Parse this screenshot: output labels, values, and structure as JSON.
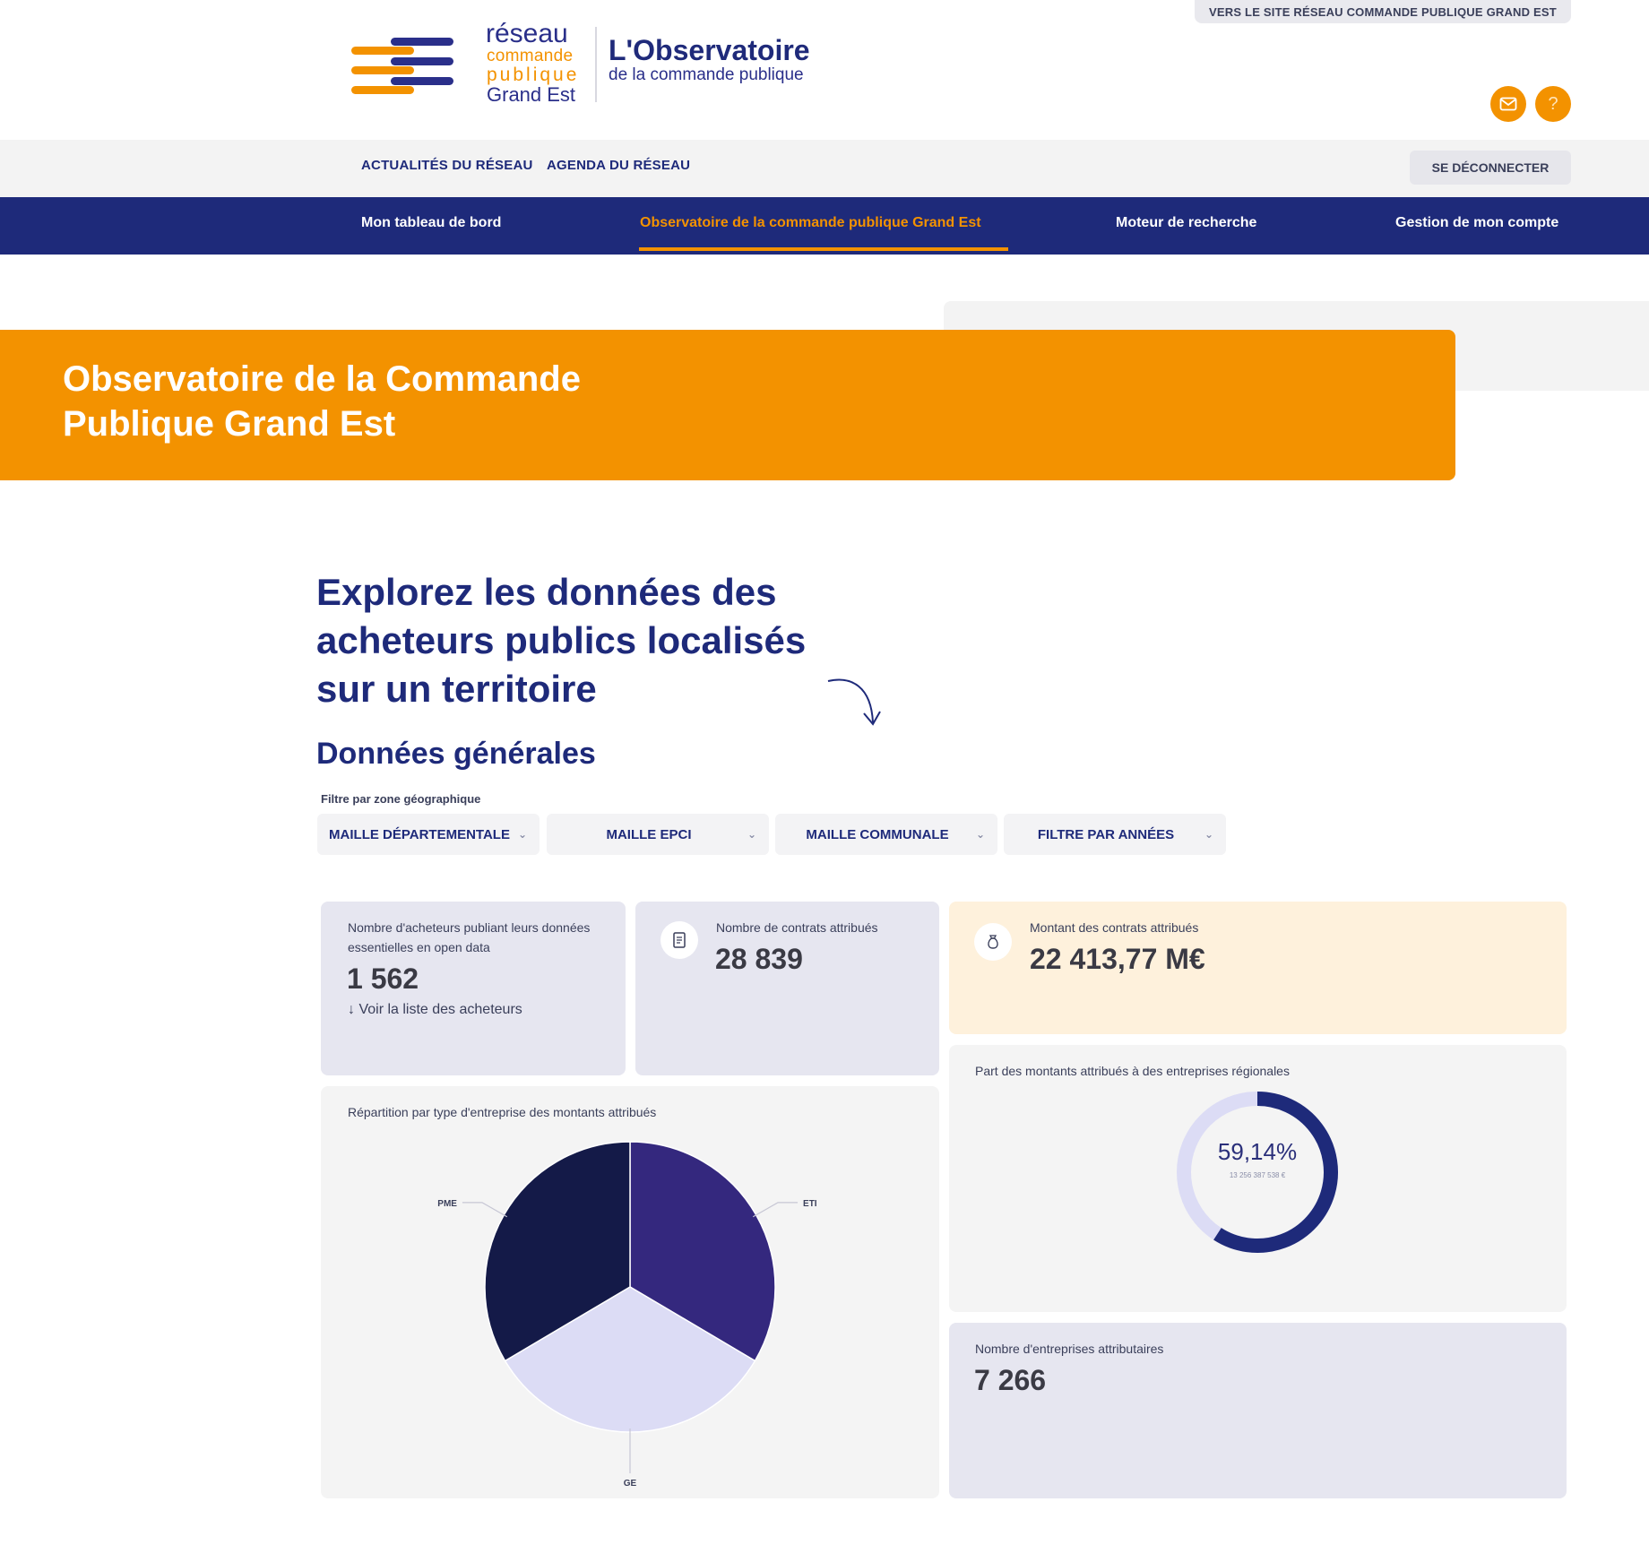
{
  "header": {
    "top_link": "VERS LE SITE RÉSEAU COMMANDE PUBLIQUE GRAND EST",
    "logo": {
      "line1": "réseau",
      "line2": "commande",
      "line3": "publique",
      "line4": "Grand Est"
    },
    "title": "L'Observatoire",
    "subtitle": "de la commande publique",
    "icons": [
      "mail-icon",
      "help-icon"
    ],
    "help_glyph": "?"
  },
  "subnav": {
    "links": [
      "ACTUALITÉS DU RÉSEAU",
      "AGENDA DU RÉSEAU"
    ],
    "logout": "SE DÉCONNECTER"
  },
  "mainnav": {
    "items": [
      {
        "label": "Mon tableau de bord",
        "active": false
      },
      {
        "label": "Observatoire de la commande publique Grand Est",
        "active": true
      },
      {
        "label": "Moteur de recherche",
        "active": false
      },
      {
        "label": "Gestion de mon compte",
        "active": false
      }
    ]
  },
  "banner": {
    "title": "Observatoire de la Commande Publique Grand Est"
  },
  "section": {
    "headline": "Explorez les données des acheteurs publics localisés sur un territoire",
    "subtitle": "Données générales",
    "filter_label": "Filtre par zone géographique",
    "filters": [
      "MAILLE DÉPARTEMENTALE",
      "MAILLE EPCI",
      "MAILLE COMMUNALE",
      "FILTRE PAR ANNÉES"
    ]
  },
  "cards": {
    "acheteurs": {
      "label": "Nombre d'acheteurs publiant leurs données essentielles en open data",
      "value": "1 562",
      "link": "↓ Voir la liste des acheteurs"
    },
    "contrats": {
      "label": "Nombre de contrats attribués",
      "value": "28 839"
    },
    "montant": {
      "label": "Montant des contrats attribués",
      "value": "22 413,77 M€"
    },
    "part": {
      "label": "Part des montants attribués à des entreprises régionales",
      "percent": "59,14%",
      "amount": "13 256 387 538 €",
      "fraction": 0.5914
    },
    "repartition": {
      "label": "Répartition par type d'entreprise des montants attribués"
    },
    "entreprises": {
      "label": "Nombre d'entreprises attributaires",
      "value": "7 266"
    }
  },
  "chart_data": {
    "type": "pie",
    "title": "Répartition par type d'entreprise des montants attribués",
    "categories": [
      "ETI",
      "GE",
      "PME"
    ],
    "values": [
      33.5,
      33,
      33.5
    ],
    "colors": [
      "#34287e",
      "#dcdcf5",
      "#141a48"
    ]
  },
  "colors": {
    "navy": "#1e2a7a",
    "orange": "#f39200",
    "lavender": "#e6e6f0",
    "cream": "#fef1dc"
  }
}
